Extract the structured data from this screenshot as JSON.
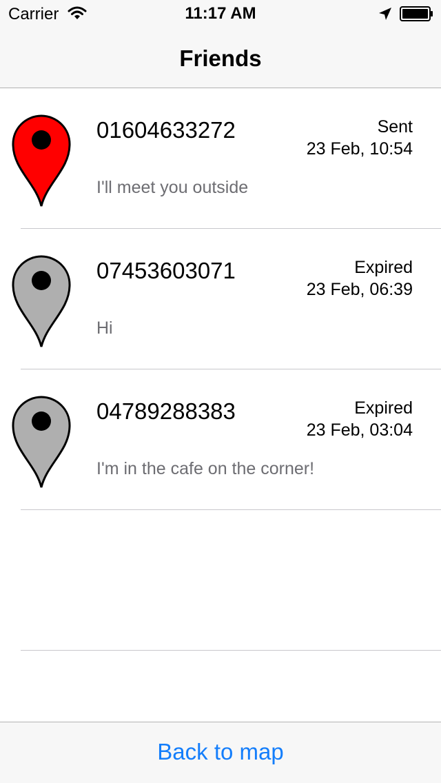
{
  "status_bar": {
    "carrier": "Carrier",
    "time": "11:17 AM",
    "wifi_icon": "wifi-icon",
    "location_icon": "location-arrow-icon",
    "battery_icon": "battery-full-icon"
  },
  "nav": {
    "title": "Friends"
  },
  "friends": [
    {
      "number": "01604633272",
      "status": "Sent",
      "date": "23 Feb, 10:54",
      "message": "I'll meet you outside",
      "pin_color": "#ff0000",
      "pin_icon": "map-pin-icon"
    },
    {
      "number": "07453603071",
      "status": "Expired",
      "date": "23 Feb, 06:39",
      "message": "Hi",
      "pin_color": "#afafaf",
      "pin_icon": "map-pin-icon"
    },
    {
      "number": "04789288383",
      "status": "Expired",
      "date": "23 Feb, 03:04",
      "message": "I'm in the cafe on the corner!",
      "pin_color": "#afafaf",
      "pin_icon": "map-pin-icon"
    }
  ],
  "toolbar": {
    "back_label": "Back to map"
  },
  "colors": {
    "accent": "#147efb",
    "bar_background": "#f7f7f7",
    "secondary_text": "#6d6d72",
    "separator": "#c8c7cc"
  }
}
